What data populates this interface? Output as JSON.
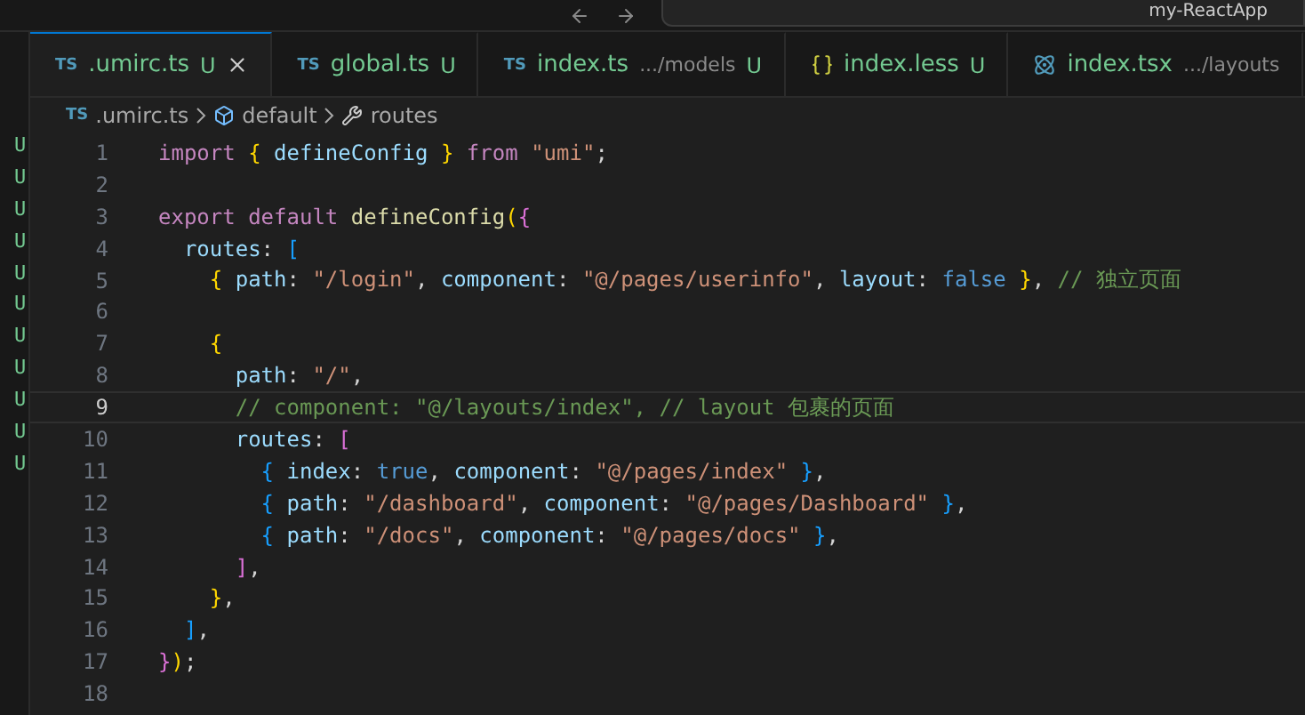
{
  "title_bar": {
    "project": "my-ReactApp"
  },
  "scm_markers": [
    "U",
    "U",
    "U",
    "U",
    "U",
    "U",
    "U",
    "U",
    "U",
    "U",
    "U"
  ],
  "tabs": [
    {
      "kind": "typescript",
      "badge": "TS",
      "name": ".umirc.ts",
      "status": "U",
      "selected": true
    },
    {
      "kind": "typescript",
      "badge": "TS",
      "name": "global.ts",
      "status": "U",
      "selected": false
    },
    {
      "kind": "typescript",
      "badge": "TS",
      "name": "index.ts",
      "description": ".../models",
      "status": "U",
      "selected": false
    },
    {
      "kind": "styles",
      "name": "index.less",
      "status": "U",
      "selected": false
    },
    {
      "kind": "react",
      "name": "index.tsx",
      "description": ".../layouts",
      "selected": false
    }
  ],
  "breadcrumb": [
    {
      "kind": "typescript",
      "badge": "TS",
      "label": ".umirc.ts"
    },
    {
      "kind": "module",
      "label": "default"
    },
    {
      "kind": "property",
      "label": "routes"
    }
  ],
  "lines": [
    {
      "number": "1",
      "current": false,
      "tokens": [
        {
          "t": "import ",
          "kind": "keyword"
        },
        {
          "t": "{",
          "kind": "brace1"
        },
        {
          "t": " defineConfig ",
          "kind": "property"
        },
        {
          "t": "}",
          "kind": "brace1"
        },
        {
          "t": " from ",
          "kind": "keyword"
        },
        {
          "t": "\"umi\"",
          "kind": "string"
        },
        {
          "t": ";",
          "kind": "plain"
        }
      ]
    },
    {
      "number": "2",
      "current": false
    },
    {
      "number": "3",
      "current": false,
      "tokens": [
        {
          "t": "export default ",
          "kind": "keyword"
        },
        {
          "t": "defineConfig",
          "kind": "function"
        },
        {
          "t": "(",
          "kind": "brace1"
        },
        {
          "t": "{",
          "kind": "brace2"
        }
      ]
    },
    {
      "number": "4",
      "current": false,
      "tokens": [
        {
          "t": "  routes",
          "kind": "property"
        },
        {
          "t": ": ",
          "kind": "plain"
        },
        {
          "t": "[",
          "kind": "brace3"
        }
      ]
    },
    {
      "number": "5",
      "current": false,
      "tokens": [
        {
          "t": "    {",
          "kind": "brace1"
        },
        {
          "t": " path",
          "kind": "property"
        },
        {
          "t": ": ",
          "kind": "plain"
        },
        {
          "t": "\"/login\"",
          "kind": "string"
        },
        {
          "t": ", ",
          "kind": "plain"
        },
        {
          "t": "component",
          "kind": "property"
        },
        {
          "t": ": ",
          "kind": "plain"
        },
        {
          "t": "\"@/pages/userinfo\"",
          "kind": "string"
        },
        {
          "t": ", ",
          "kind": "plain"
        },
        {
          "t": "layout",
          "kind": "property"
        },
        {
          "t": ": ",
          "kind": "plain"
        },
        {
          "t": "false",
          "kind": "boolean"
        },
        {
          "t": " }",
          "kind": "brace1"
        },
        {
          "t": ", ",
          "kind": "plain"
        },
        {
          "t": "// 独立页面",
          "kind": "comment"
        }
      ]
    },
    {
      "number": "6",
      "current": false
    },
    {
      "number": "7",
      "current": false,
      "tokens": [
        {
          "t": "    {",
          "kind": "brace1"
        }
      ]
    },
    {
      "number": "8",
      "current": false,
      "tokens": [
        {
          "t": "      path",
          "kind": "property"
        },
        {
          "t": ": ",
          "kind": "plain"
        },
        {
          "t": "\"/\"",
          "kind": "string"
        },
        {
          "t": ",",
          "kind": "plain"
        }
      ]
    },
    {
      "number": "9",
      "current": true,
      "tokens": [
        {
          "t": "      // component: \"@/layouts/index\", // layout 包裹的页面",
          "kind": "comment"
        }
      ]
    },
    {
      "number": "10",
      "current": false,
      "tokens": [
        {
          "t": "      routes",
          "kind": "property"
        },
        {
          "t": ": ",
          "kind": "plain"
        },
        {
          "t": "[",
          "kind": "brace2"
        }
      ]
    },
    {
      "number": "11",
      "current": false,
      "tokens": [
        {
          "t": "        {",
          "kind": "brace3"
        },
        {
          "t": " index",
          "kind": "property"
        },
        {
          "t": ": ",
          "kind": "plain"
        },
        {
          "t": "true",
          "kind": "boolean"
        },
        {
          "t": ", ",
          "kind": "plain"
        },
        {
          "t": "component",
          "kind": "property"
        },
        {
          "t": ": ",
          "kind": "plain"
        },
        {
          "t": "\"@/pages/index\"",
          "kind": "string"
        },
        {
          "t": " }",
          "kind": "brace3"
        },
        {
          "t": ",",
          "kind": "plain"
        }
      ]
    },
    {
      "number": "12",
      "current": false,
      "tokens": [
        {
          "t": "        {",
          "kind": "brace3"
        },
        {
          "t": " path",
          "kind": "property"
        },
        {
          "t": ": ",
          "kind": "plain"
        },
        {
          "t": "\"/dashboard\"",
          "kind": "string"
        },
        {
          "t": ", ",
          "kind": "plain"
        },
        {
          "t": "component",
          "kind": "property"
        },
        {
          "t": ": ",
          "kind": "plain"
        },
        {
          "t": "\"@/pages/Dashboard\"",
          "kind": "string"
        },
        {
          "t": " }",
          "kind": "brace3"
        },
        {
          "t": ",",
          "kind": "plain"
        }
      ]
    },
    {
      "number": "13",
      "current": false,
      "tokens": [
        {
          "t": "        {",
          "kind": "brace3"
        },
        {
          "t": " path",
          "kind": "property"
        },
        {
          "t": ": ",
          "kind": "plain"
        },
        {
          "t": "\"/docs\"",
          "kind": "string"
        },
        {
          "t": ", ",
          "kind": "plain"
        },
        {
          "t": "component",
          "kind": "property"
        },
        {
          "t": ": ",
          "kind": "plain"
        },
        {
          "t": "\"@/pages/docs\"",
          "kind": "string"
        },
        {
          "t": " }",
          "kind": "brace3"
        },
        {
          "t": ",",
          "kind": "plain"
        }
      ]
    },
    {
      "number": "14",
      "current": false,
      "tokens": [
        {
          "t": "      ]",
          "kind": "brace2"
        },
        {
          "t": ",",
          "kind": "plain"
        }
      ]
    },
    {
      "number": "15",
      "current": false,
      "tokens": [
        {
          "t": "    }",
          "kind": "brace1"
        },
        {
          "t": ",",
          "kind": "plain"
        }
      ]
    },
    {
      "number": "16",
      "current": false,
      "tokens": [
        {
          "t": "  ]",
          "kind": "brace3"
        },
        {
          "t": ",",
          "kind": "plain"
        }
      ]
    },
    {
      "number": "17",
      "current": false,
      "tokens": [
        {
          "t": "}",
          "kind": "brace2"
        },
        {
          "t": ")",
          "kind": "brace1"
        },
        {
          "t": ";",
          "kind": "plain"
        }
      ]
    },
    {
      "number": "18",
      "current": false
    }
  ]
}
